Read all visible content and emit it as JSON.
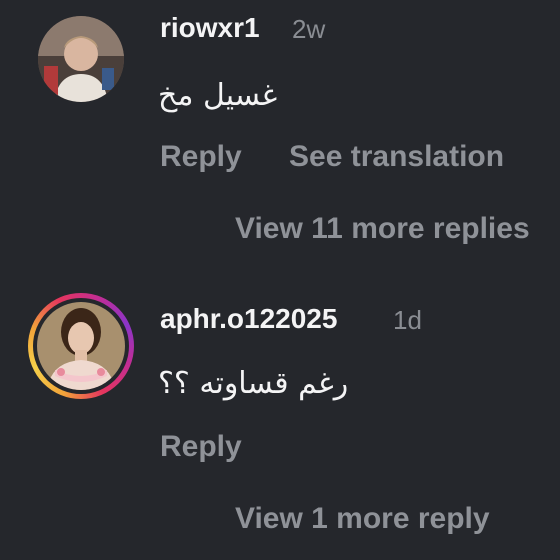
{
  "comments": [
    {
      "username": "riowxr1",
      "time": "2w",
      "text": "غسيل مخ",
      "reply_label": "Reply",
      "translate_label": "See translation",
      "view_more_label": "View 11 more replies"
    },
    {
      "username": "aphr.o122025",
      "time": "1d",
      "text": "رغم قساوته ؟؟",
      "reply_label": "Reply",
      "view_more_label": "View 1 more reply"
    }
  ],
  "colors": {
    "background": "#25272c",
    "primary_text": "#f4f4f5",
    "secondary_text": "#8f9298",
    "story_ring": "#e5355e"
  }
}
